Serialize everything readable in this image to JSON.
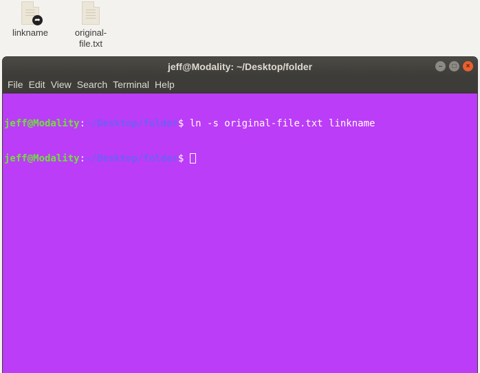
{
  "desktop": {
    "icons": [
      {
        "label": "linkname",
        "icon": "symlink-file-icon"
      },
      {
        "label": "original-\nfile.txt",
        "icon": "text-file-icon"
      }
    ]
  },
  "terminal": {
    "title": "jeff@Modality: ~/Desktop/folder",
    "window_buttons": {
      "minimize": "–",
      "maximize": "□",
      "close": "×"
    },
    "menu": [
      "File",
      "Edit",
      "View",
      "Search",
      "Terminal",
      "Help"
    ],
    "lines": [
      {
        "user": "jeff@Modality",
        "sep": ":",
        "path": "~/Desktop/folder",
        "prompt": "$ ",
        "command": "ln -s original-file.txt linkname"
      },
      {
        "user": "jeff@Modality",
        "sep": ":",
        "path": "~/Desktop/folder",
        "prompt": "$ ",
        "command": ""
      }
    ],
    "colors": {
      "background": "#bb3df7",
      "user": "#6fe03a",
      "path": "#6f5ef7"
    }
  }
}
